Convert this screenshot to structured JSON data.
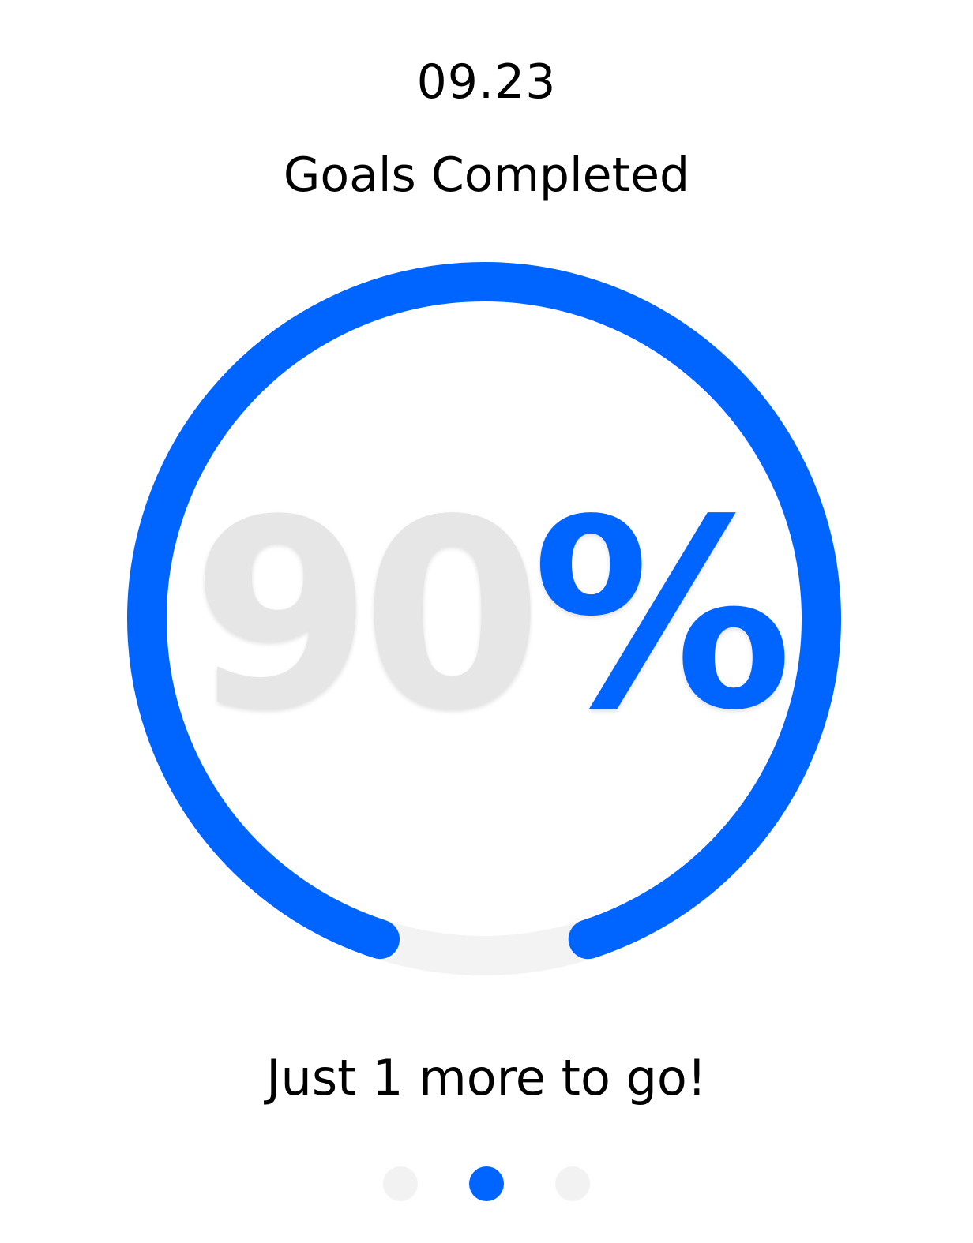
{
  "date": "09.23",
  "title": "Goals Completed",
  "progress": {
    "fraction": 0.9,
    "value_text": "90",
    "unit_text": "%",
    "track_color": "#f3f3f3",
    "fill_color": "#0064ff"
  },
  "message": "Just 1 more to go!",
  "pagination": {
    "pages": 3,
    "active_index": 1,
    "active_color": "#0064ff",
    "inactive_color": "#f2f2f2"
  }
}
